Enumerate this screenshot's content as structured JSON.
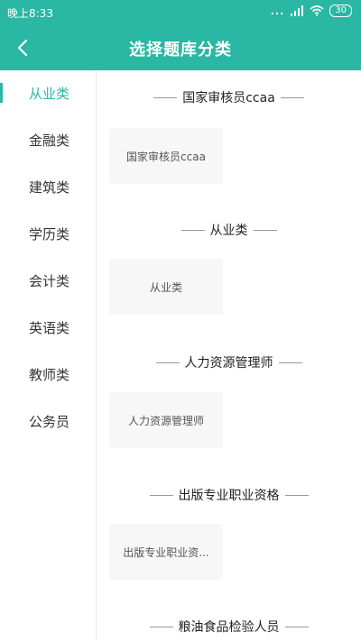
{
  "status": {
    "time": "晚上8:33",
    "signal_dots": "...",
    "battery": "30"
  },
  "header": {
    "title": "选择题库分类"
  },
  "sidebar": {
    "items": [
      {
        "label": "从业类"
      },
      {
        "label": "金融类"
      },
      {
        "label": "建筑类"
      },
      {
        "label": "学历类"
      },
      {
        "label": "会计类"
      },
      {
        "label": "英语类"
      },
      {
        "label": "教师类"
      },
      {
        "label": "公务员"
      }
    ]
  },
  "sections": [
    {
      "title": "国家审核员ccaa",
      "card": "国家审核员ccaa"
    },
    {
      "title": "从业类",
      "card": "从业类"
    },
    {
      "title": "人力资源管理师",
      "card": "人力资源管理师"
    },
    {
      "title": "出版专业职业资格",
      "card": "出版专业职业资..."
    },
    {
      "title": "粮油食品检验人员"
    }
  ],
  "colors": {
    "accent": "#2ab7a3"
  }
}
